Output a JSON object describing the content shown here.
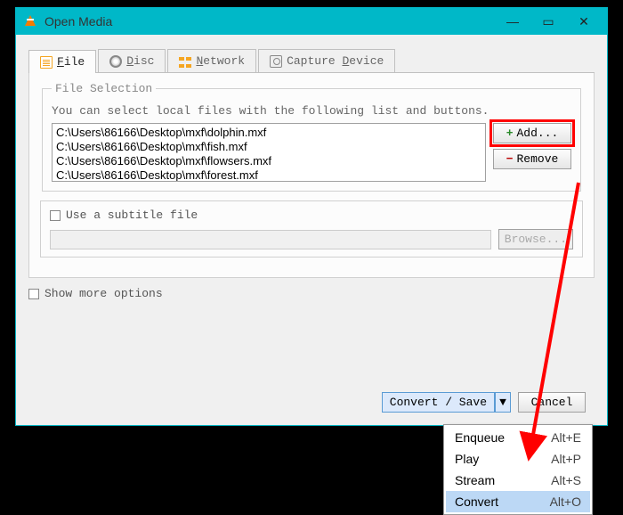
{
  "title": "Open Media",
  "tabs": {
    "file": "File",
    "disc": "Disc",
    "network": "Network",
    "capture": "Capture Device"
  },
  "fileSelection": {
    "legend": "File Selection",
    "hint": "You can select local files with the following list and buttons.",
    "items": [
      "C:\\Users\\86166\\Desktop\\mxf\\dolphin.mxf",
      "C:\\Users\\86166\\Desktop\\mxf\\fish.mxf",
      "C:\\Users\\86166\\Desktop\\mxf\\flowsers.mxf",
      "C:\\Users\\86166\\Desktop\\mxf\\forest.mxf"
    ],
    "add": "Add...",
    "remove": "Remove"
  },
  "subtitle": {
    "label": "Use a subtitle file",
    "browse": "Browse..."
  },
  "showMore": "Show more options",
  "convertSave": "Convert / Save",
  "cancel": "Cancel",
  "menu": {
    "enqueue": {
      "label": "Enqueue",
      "sc": "Alt+E"
    },
    "play": {
      "label": "Play",
      "sc": "Alt+P"
    },
    "stream": {
      "label": "Stream",
      "sc": "Alt+S"
    },
    "convert": {
      "label": "Convert",
      "sc": "Alt+O"
    }
  }
}
